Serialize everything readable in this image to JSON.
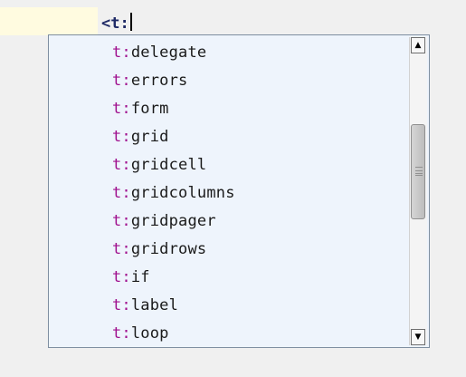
{
  "editor": {
    "open_tag": "<",
    "typed_prefix": "t:"
  },
  "completion": {
    "namespace": "t:",
    "items": [
      {
        "ns": "t:",
        "name": "delegate"
      },
      {
        "ns": "t:",
        "name": "errors"
      },
      {
        "ns": "t:",
        "name": "form"
      },
      {
        "ns": "t:",
        "name": "grid"
      },
      {
        "ns": "t:",
        "name": "gridcell"
      },
      {
        "ns": "t:",
        "name": "gridcolumns"
      },
      {
        "ns": "t:",
        "name": "gridpager"
      },
      {
        "ns": "t:",
        "name": "gridrows"
      },
      {
        "ns": "t:",
        "name": "if"
      },
      {
        "ns": "t:",
        "name": "label"
      },
      {
        "ns": "t:",
        "name": "loop"
      }
    ],
    "colors": {
      "namespace": "#a0108e",
      "name": "#1a1a1a",
      "popup_background": "#eef4fc"
    }
  },
  "scrollbar": {
    "up_arrow": "▲",
    "down_arrow": "▼",
    "position_fraction": 0.35
  }
}
